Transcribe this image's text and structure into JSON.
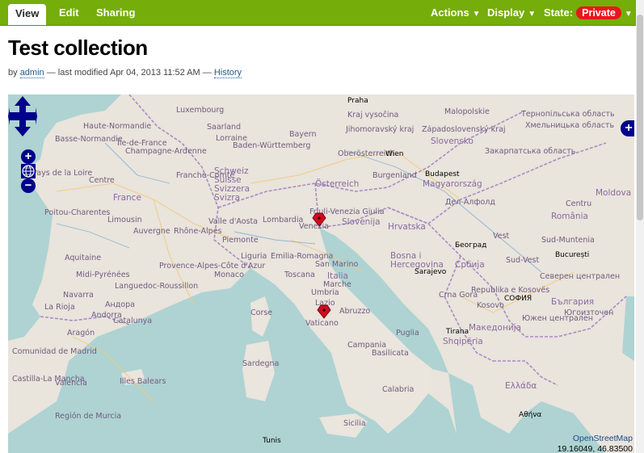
{
  "toolbar": {
    "tabs": [
      {
        "label": "View"
      },
      {
        "label": "Edit"
      },
      {
        "label": "Sharing"
      }
    ],
    "actions_label": "Actions",
    "display_label": "Display",
    "state_label": "State:",
    "state_value": "Private",
    "caret": "▼",
    "colors": {
      "bar": "#75ad0a",
      "state_badge": "#e8171d"
    }
  },
  "page": {
    "title": "Test collection",
    "byline_prefix": "by",
    "author": "admin",
    "modified": "— last modified Apr 04, 2013 11:52 AM —",
    "history_link": "History"
  },
  "map": {
    "controls": {
      "pan_icon": "pan-arrows-icon",
      "zoom_in": "+",
      "zoom_out": "−",
      "world_icon": "globe-icon",
      "layer_switcher": "+"
    },
    "attribution": "OpenStreetMap",
    "coordinates": "19.16049, 46.83500",
    "labels": [
      {
        "text": "Praha"
      },
      {
        "text": "Luxembourg"
      },
      {
        "text": "Saarland"
      },
      {
        "text": "Haute-Normandie"
      },
      {
        "text": "Basse-Normandie"
      },
      {
        "text": "Île-de-France"
      },
      {
        "text": "Champagne-Ardenne"
      },
      {
        "text": "Lorraine"
      },
      {
        "text": "Bayern"
      },
      {
        "text": "Baden-Württemberg"
      },
      {
        "text": "Oberösterreich"
      },
      {
        "text": "Wien"
      },
      {
        "text": "Slovensko"
      },
      {
        "text": "Západoslovenský kraj"
      },
      {
        "text": "Kraj vysočina"
      },
      {
        "text": "Jihomoravský kraj"
      },
      {
        "text": "Malopolskie"
      },
      {
        "text": "Budapest"
      },
      {
        "text": "Magyarország"
      },
      {
        "text": "Österreich"
      },
      {
        "text": "Burgenland"
      },
      {
        "text": "Pays de la Loire"
      },
      {
        "text": "Centre"
      },
      {
        "text": "Franche-Comté"
      },
      {
        "text": "Schweiz Suisse Svizzera Svizra"
      },
      {
        "text": "France"
      },
      {
        "text": "Poitou-Charentes"
      },
      {
        "text": "Limousin"
      },
      {
        "text": "Auvergne"
      },
      {
        "text": "Rhône-Alpes"
      },
      {
        "text": "Valle d'Aosta"
      },
      {
        "text": "Lombardia"
      },
      {
        "text": "Piemonte"
      },
      {
        "text": "Venezia"
      },
      {
        "text": "Friuli-Venezia Giulia"
      },
      {
        "text": "Slovenija"
      },
      {
        "text": "Hrvatska"
      },
      {
        "text": "Aquitaine"
      },
      {
        "text": "Midi-Pyrénées"
      },
      {
        "text": "Languedoc-Roussillon"
      },
      {
        "text": "Provence-Alpes-Côte d'Azur"
      },
      {
        "text": "Monaco"
      },
      {
        "text": "Liguria"
      },
      {
        "text": "Emilia-Romagna"
      },
      {
        "text": "Toscana"
      },
      {
        "text": "San Marino"
      },
      {
        "text": "Marche"
      },
      {
        "text": "Umbria"
      },
      {
        "text": "Italia"
      },
      {
        "text": "Lazio"
      },
      {
        "text": "Abruzzo"
      },
      {
        "text": "Vaticano"
      },
      {
        "text": "Bosna i Hercegovina"
      },
      {
        "text": "Sarajevo"
      },
      {
        "text": "Србија"
      },
      {
        "text": "Београд"
      },
      {
        "text": "Crna Gora"
      },
      {
        "text": "Republika e Kosovës"
      },
      {
        "text": "Kosovo"
      },
      {
        "text": "Tirana"
      },
      {
        "text": "Shqipëria"
      },
      {
        "text": "Македонија"
      },
      {
        "text": "СОФИЯ"
      },
      {
        "text": "България"
      },
      {
        "text": "România"
      },
      {
        "text": "București"
      },
      {
        "text": "Moldova"
      },
      {
        "text": "Закарпатська область"
      },
      {
        "text": "Хмельницька область"
      },
      {
        "text": "Тернопільська область"
      },
      {
        "text": "Дел-Алфолд"
      },
      {
        "text": "Андора"
      },
      {
        "text": "Andorra"
      },
      {
        "text": "Catalunya"
      },
      {
        "text": "Aragón"
      },
      {
        "text": "La Rioja"
      },
      {
        "text": "Navarra"
      },
      {
        "text": "Comunidad de Madrid"
      },
      {
        "text": "Castilla-La Mancha"
      },
      {
        "text": "Valencia"
      },
      {
        "text": "Illes Balears"
      },
      {
        "text": "Región de Murcia"
      },
      {
        "text": "Corse"
      },
      {
        "text": "Sardegna"
      },
      {
        "text": "Campania"
      },
      {
        "text": "Basilicata"
      },
      {
        "text": "Puglia"
      },
      {
        "text": "Calabria"
      },
      {
        "text": "Sicilia"
      },
      {
        "text": "Tunis"
      },
      {
        "text": "Ελλάδα"
      },
      {
        "text": "Αθήνα"
      },
      {
        "text": "Южен централен"
      },
      {
        "text": "Югоизточен"
      },
      {
        "text": "Северен централен"
      },
      {
        "text": "Sud-Muntenia"
      },
      {
        "text": "Centru"
      },
      {
        "text": "Vest"
      },
      {
        "text": "Sud-Vest"
      }
    ],
    "markers": [
      {
        "name": "marker-venezia",
        "color": "#d10a1e"
      },
      {
        "name": "marker-roma",
        "color": "#d10a1e"
      }
    ],
    "colors": {
      "land": "#e9e4dc",
      "sea": "#aed3d2",
      "border": "#a98cc4",
      "road": "#f5c97b"
    }
  }
}
